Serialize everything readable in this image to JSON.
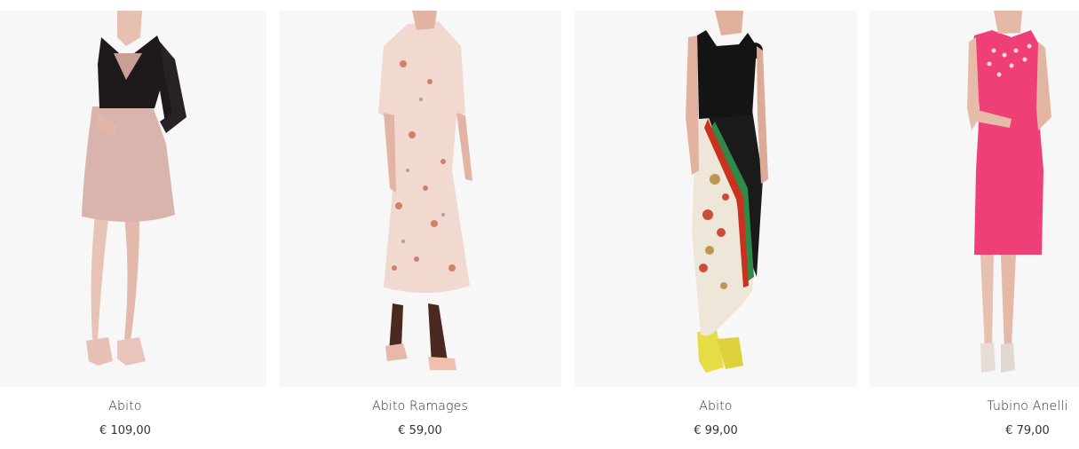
{
  "products": [
    {
      "name": "Abito",
      "price": "€ 109,00",
      "image": "model-lace-top-pink-skirt-dress"
    },
    {
      "name": "Abito Ramages",
      "price": "€ 59,00",
      "image": "model-floral-print-midi-dress"
    },
    {
      "name": "Abito",
      "price": "€ 99,00",
      "image": "model-black-top-scarf-print-skirt-dress"
    },
    {
      "name": "Tubino Anelli",
      "price": "€ 79,00",
      "image": "model-fuchsia-sheath-dress"
    }
  ],
  "colors": {
    "photo_bg": "#f8f7f8",
    "text": "#2b2b2b",
    "dress1_lace": "#1e1a1c",
    "dress1_skirt": "#d9b4ad",
    "dress2_base": "#f2d9cf",
    "dress3_top": "#141414",
    "dress3_scarf": "#efe6da",
    "dress4": "#ee3f76"
  }
}
